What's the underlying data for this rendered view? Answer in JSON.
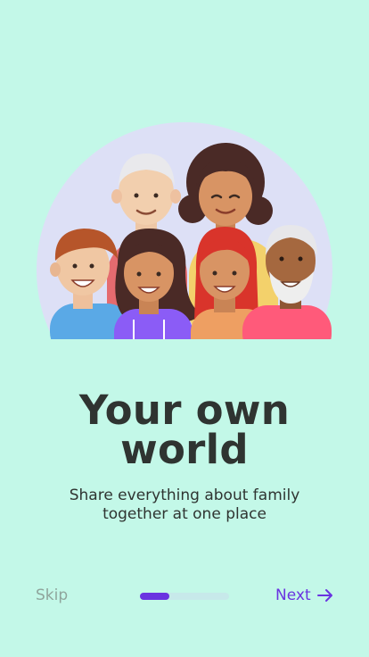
{
  "onboarding": {
    "title_line1": "Your own",
    "title_line2": "world",
    "subtitle_line1": "Share everything about family",
    "subtitle_line2": "together at one place",
    "skip_label": "Skip",
    "next_label": "Next",
    "progress_fraction": 0.33
  },
  "colors": {
    "background": "#c3f8e8",
    "accent": "#6a34e0",
    "text": "#2f3431",
    "muted": "#8fa59c",
    "progress_track": "#c7e9ea",
    "circle": "#dde0f6"
  },
  "icons": {
    "next": "arrow-right-icon",
    "illustration": "family-group-illustration"
  }
}
